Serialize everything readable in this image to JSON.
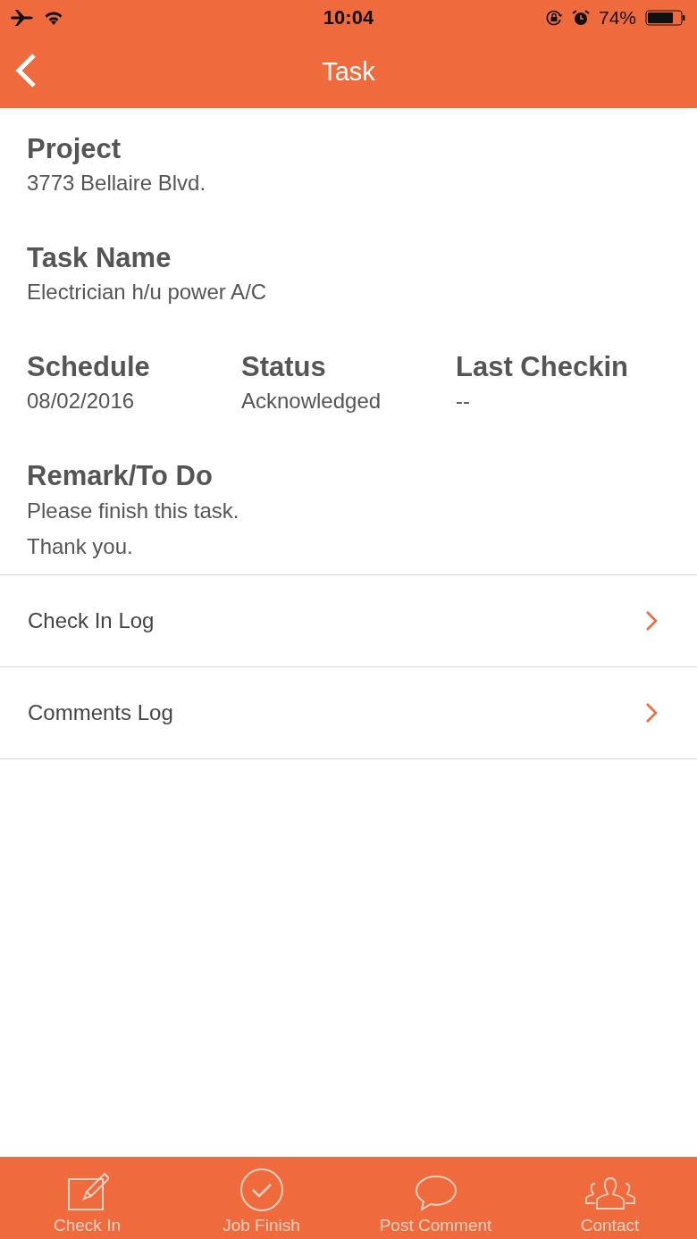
{
  "status_bar": {
    "time": "10:04",
    "battery": "74%"
  },
  "nav_bar": {
    "title": "Task"
  },
  "fields": [
    {
      "label": "Project",
      "values": [
        "3773 Bellaire Blvd."
      ]
    },
    {
      "label": "Task Name",
      "values": [
        "Electrician h/u power A/C"
      ]
    }
  ],
  "columns": [
    {
      "label": "Schedule",
      "value": "08/02/2016"
    },
    {
      "label": "Status",
      "value": "Acknowledged"
    },
    {
      "label": "Last Checkin",
      "value": "--"
    }
  ],
  "remark": {
    "label": "Remark/To Do",
    "values": [
      "Please finish this task.",
      "Thank you."
    ]
  },
  "links": [
    {
      "label": "Check In Log"
    },
    {
      "label": "Comments Log"
    }
  ],
  "tab_bar": [
    {
      "kind": "edit",
      "label": "Check In"
    },
    {
      "kind": "check",
      "label": "Job Finish"
    },
    {
      "kind": "comment",
      "label": "Post Comment"
    },
    {
      "kind": "people",
      "label": "Contact"
    }
  ]
}
